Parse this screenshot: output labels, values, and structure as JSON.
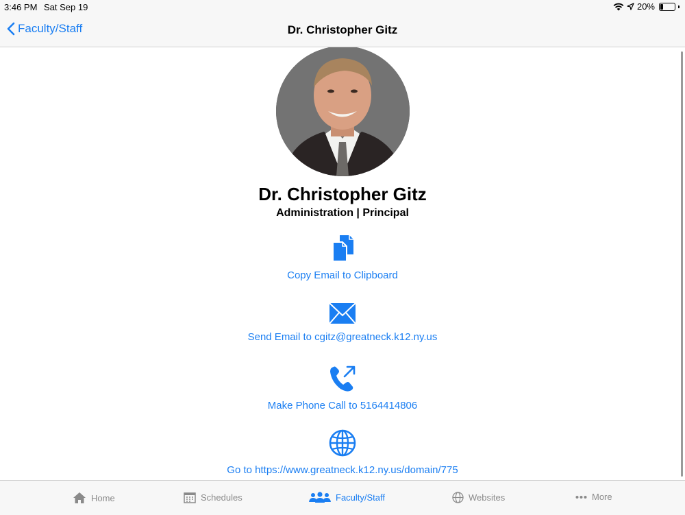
{
  "status_bar": {
    "time": "3:46 PM",
    "date": "Sat Sep 19",
    "battery": "20%",
    "battery_level": 0.2
  },
  "nav": {
    "back_label": "Faculty/Staff",
    "title": "Dr. Christopher Gitz"
  },
  "profile": {
    "name": "Dr. Christopher Gitz",
    "role": "Administration | Principal"
  },
  "actions": {
    "copy_email": "Copy Email to Clipboard",
    "send_email": "Send Email to cgitz@greatneck.k12.ny.us",
    "phone_call": "Make Phone Call to 5164414806",
    "website": "Go to https://www.greatneck.k12.ny.us/domain/775"
  },
  "tabs": [
    {
      "label": "Home",
      "icon": "house-icon",
      "active": false
    },
    {
      "label": "Schedules",
      "icon": "calendar-icon",
      "active": false
    },
    {
      "label": "Faculty/Staff",
      "icon": "people-icon",
      "active": true
    },
    {
      "label": "Websites",
      "icon": "globe-icon",
      "active": false
    },
    {
      "label": "More",
      "icon": "ellipsis-icon",
      "active": false
    }
  ],
  "colors": {
    "accent": "#1a7ef2",
    "inactive": "#8a8a8a",
    "bar_bg": "#f7f7f7"
  }
}
